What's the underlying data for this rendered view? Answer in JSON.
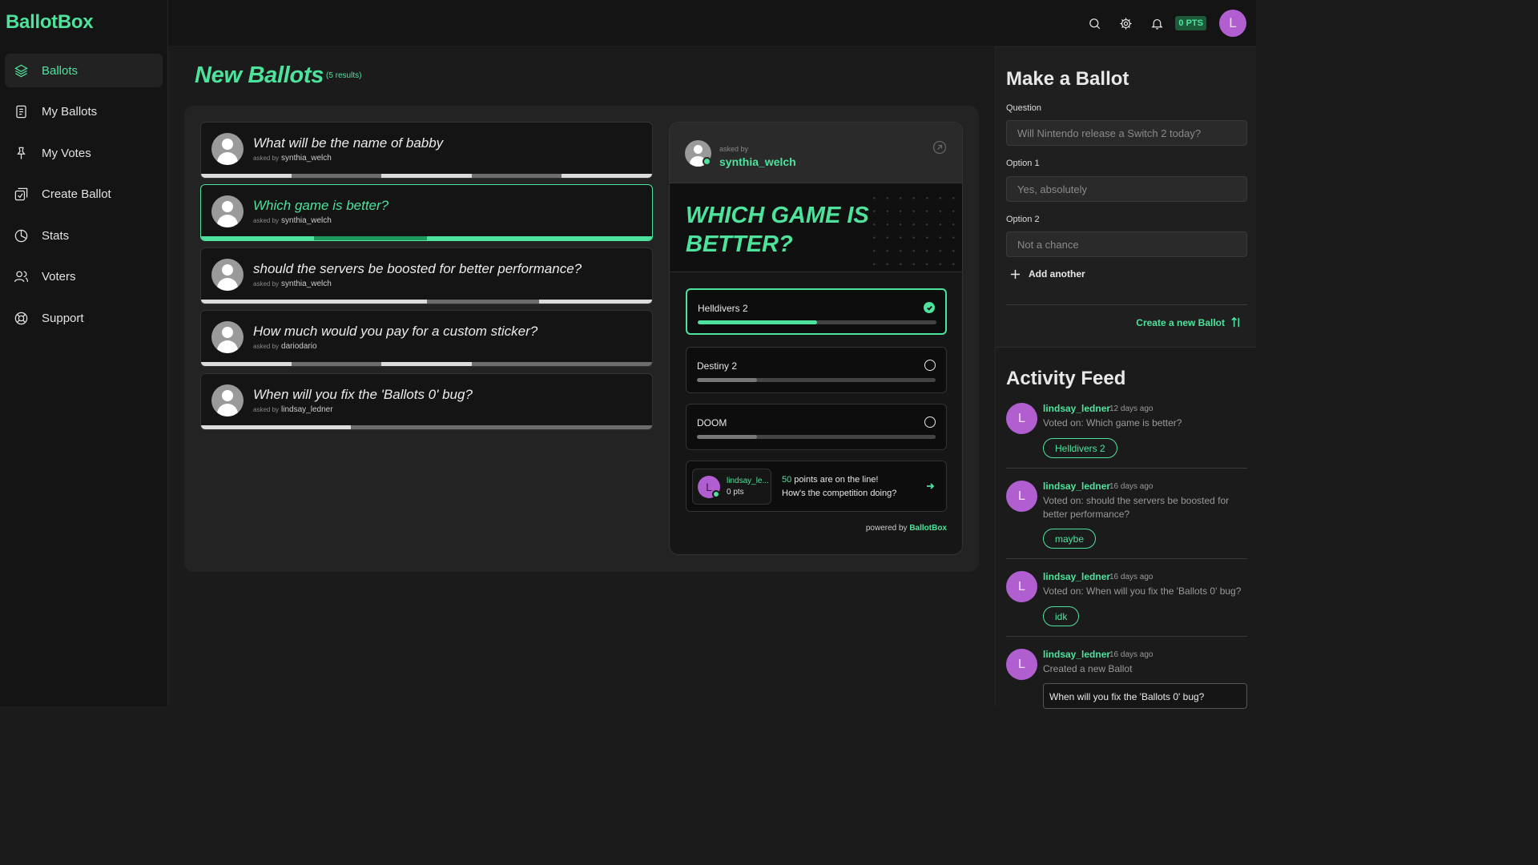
{
  "app": {
    "name": "BallotBox",
    "accent": "#4ee39c",
    "avatar_color": "#b15ed1"
  },
  "sidebar": {
    "items": [
      {
        "label": "Ballots",
        "icon": "layers-icon",
        "active": true
      },
      {
        "label": "My Ballots",
        "icon": "document-icon"
      },
      {
        "label": "My Votes",
        "icon": "pin-icon"
      },
      {
        "label": "Create Ballot",
        "icon": "create-icon"
      },
      {
        "label": "Stats",
        "icon": "pie-chart-icon"
      },
      {
        "label": "Voters",
        "icon": "users-icon"
      },
      {
        "label": "Support",
        "icon": "lifebuoy-icon"
      }
    ]
  },
  "topbar": {
    "icons": [
      "search-icon",
      "gear-icon",
      "bell-icon"
    ],
    "points": "0 PTS",
    "avatar_initial": "L"
  },
  "main": {
    "title": "New Ballots",
    "results": "(5 results)",
    "ballots": [
      {
        "question": "What will be the name of babby",
        "asked_prefix": "asked by",
        "user": "synthia_welch"
      },
      {
        "question": "Which game is better?",
        "asked_prefix": "asked by",
        "user": "synthia_welch"
      },
      {
        "question": "should the servers be boosted for better performance?",
        "asked_prefix": "asked by",
        "user": "synthia_welch"
      },
      {
        "question": "How much would you pay for a custom sticker?",
        "asked_prefix": "asked by",
        "user": "dariodario"
      },
      {
        "question": "When will you fix the 'Ballots 0' bug?",
        "asked_prefix": "asked by",
        "user": "lindsay_ledner"
      }
    ]
  },
  "detail": {
    "asked_prefix": "asked by",
    "user": "synthia_welch",
    "question": "Which game is better?",
    "options": [
      {
        "label": "Helldivers 2",
        "selected": true,
        "share": 0.5
      },
      {
        "label": "Destiny 2",
        "selected": false,
        "share": 0.25
      },
      {
        "label": "DOOM",
        "selected": false,
        "share": 0.25
      }
    ],
    "points": {
      "user": "lindsay_le...",
      "user_initial": "L",
      "user_points": "0 pts",
      "amount": "50",
      "line1_rest": " points are on the line!",
      "line2": "How's the competition doing?"
    },
    "powered_prefix": "powered by",
    "powered_brand": "BallotBox"
  },
  "make_ballot": {
    "title": "Make a Ballot",
    "question_label": "Question",
    "question_placeholder": "Will Nintendo release a Switch 2 today?",
    "option1_label": "Option 1",
    "option1_placeholder": "Yes, absolutely",
    "option2_label": "Option 2",
    "option2_placeholder": "Not a chance",
    "add_another": "Add another",
    "create_label": "Create a new Ballot"
  },
  "activity": {
    "title": "Activity Feed",
    "items": [
      {
        "initial": "L",
        "user": "lindsay_ledner",
        "time": "12 days ago",
        "text": "Voted on: Which game is better?",
        "pill": "Helldivers 2"
      },
      {
        "initial": "L",
        "user": "lindsay_ledner",
        "time": "16 days ago",
        "text": "Voted on: should the servers be boosted for better performance?",
        "pill": "maybe"
      },
      {
        "initial": "L",
        "user": "lindsay_ledner",
        "time": "16 days ago",
        "text": "Voted on: When will you fix the 'Ballots 0' bug?",
        "pill": "idk"
      },
      {
        "initial": "L",
        "user": "lindsay_ledner",
        "time": "16 days ago",
        "text": "Created a new Ballot",
        "box": "When will you fix the 'Ballots 0' bug?"
      }
    ]
  }
}
